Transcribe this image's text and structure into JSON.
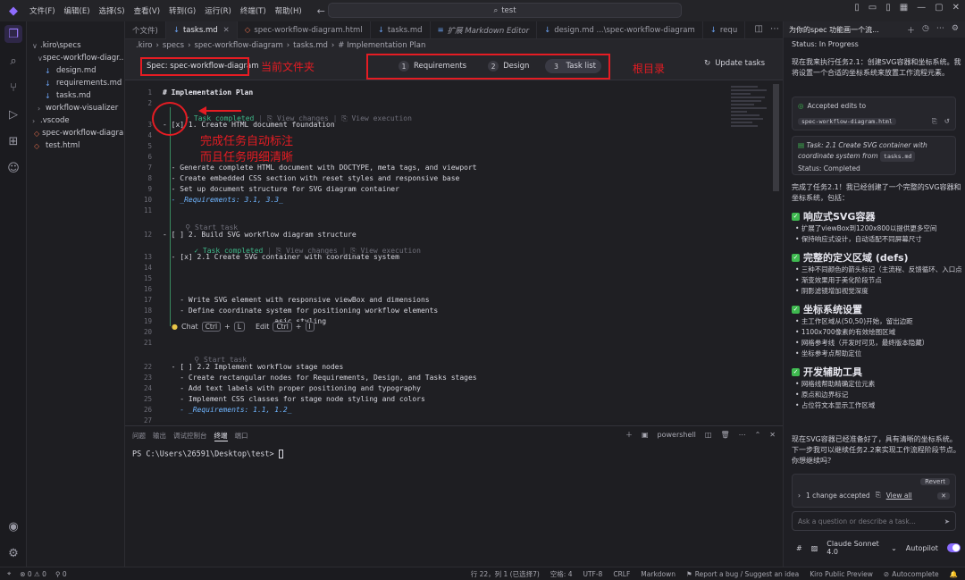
{
  "titlebar": {
    "menu": [
      "文件(F)",
      "编辑(E)",
      "选择(S)",
      "查看(V)",
      "转到(G)",
      "运行(R)",
      "终端(T)",
      "帮助(H)"
    ],
    "search": "test"
  },
  "explorer": {
    "items": [
      {
        "label": ".kiro\\specs",
        "indent": 0,
        "chev": "∨",
        "type": "folder"
      },
      {
        "label": "spec-workflow-diagr...",
        "indent": 1,
        "chev": "∨",
        "type": "folder"
      },
      {
        "label": "design.md",
        "indent": 2,
        "chev": "",
        "type": "md"
      },
      {
        "label": "requirements.md",
        "indent": 2,
        "chev": "",
        "type": "md"
      },
      {
        "label": "tasks.md",
        "indent": 2,
        "chev": "",
        "type": "md"
      },
      {
        "label": "workflow-visualizer",
        "indent": 1,
        "chev": "›",
        "type": "folder"
      },
      {
        "label": ".vscode",
        "indent": 0,
        "chev": "›",
        "type": "folder"
      },
      {
        "label": "spec-workflow-diagra...",
        "indent": 0,
        "chev": "",
        "type": "html"
      },
      {
        "label": "test.html",
        "indent": 0,
        "chev": "",
        "type": "html"
      }
    ]
  },
  "tabs": [
    {
      "label": "个文件)",
      "type": "none",
      "active": false
    },
    {
      "label": "tasks.md",
      "type": "md",
      "active": true
    },
    {
      "label": "spec-workflow-diagram.html",
      "type": "html",
      "active": false
    },
    {
      "label": "tasks.md",
      "type": "md",
      "active": false
    },
    {
      "label": "扩展 Markdown Editor",
      "type": "ext",
      "active": false
    },
    {
      "label": "design.md ...\\spec-workflow-diagram",
      "type": "md",
      "active": false
    },
    {
      "label": "requ",
      "type": "md",
      "active": false
    }
  ],
  "breadcrumb": [
    ".kiro",
    "›",
    "specs",
    "›",
    "spec-workflow-diagram",
    "›",
    "tasks.md",
    "›",
    "# Implementation Plan"
  ],
  "spec": {
    "label": "Spec: spec-workflow-diagram",
    "steps": [
      {
        "num": "1",
        "label": "Requirements"
      },
      {
        "num": "2",
        "label": "Design"
      },
      {
        "num": "3",
        "label": "Task list"
      }
    ],
    "update": "Update tasks"
  },
  "annotations": {
    "current_folder": "当前文件夹",
    "root": "根目录",
    "auto_mark_1": "完成任务自动标注",
    "auto_mark_2": "而且任务明细清晰"
  },
  "editor": {
    "lines": [
      {
        "n": "1",
        "text": "# Implementation Plan",
        "cls": "h"
      },
      {
        "n": "2",
        "text": "",
        "cls": ""
      },
      {
        "n": "3",
        "text": "- [x] 1. Create HTML document foundation",
        "cls": ""
      },
      {
        "n": "4",
        "text": "",
        "cls": ""
      },
      {
        "n": "5",
        "text": "",
        "cls": ""
      },
      {
        "n": "6",
        "text": "",
        "cls": ""
      },
      {
        "n": "7",
        "text": "  - Generate complete HTML document with DOCTYPE, meta tags, and viewport",
        "cls": ""
      },
      {
        "n": "8",
        "text": "  - Create embedded CSS section with reset styles and responsive base",
        "cls": ""
      },
      {
        "n": "9",
        "text": "  - Set up document structure for SVG diagram container",
        "cls": ""
      },
      {
        "n": "10",
        "text": "  - _Requirements: 3.1, 3.3_",
        "cls": "req"
      },
      {
        "n": "11",
        "text": "",
        "cls": ""
      },
      {
        "n": "12",
        "text": "- [ ] 2. Build SVG workflow diagram structure",
        "cls": ""
      },
      {
        "n": "13",
        "text": "  - [x] 2.1 Create SVG container with coordinate system",
        "cls": ""
      },
      {
        "n": "14",
        "text": "",
        "cls": ""
      },
      {
        "n": "15",
        "text": "",
        "cls": ""
      },
      {
        "n": "16",
        "text": "",
        "cls": ""
      },
      {
        "n": "17",
        "text": "    - Write SVG element with responsive viewBox and dimensions",
        "cls": ""
      },
      {
        "n": "18",
        "text": "    - Define coordinate system for positioning workflow elements",
        "cls": ""
      },
      {
        "n": "19",
        "text": "                          asic styling",
        "cls": ""
      },
      {
        "n": "20",
        "text": "",
        "cls": ""
      },
      {
        "n": "21",
        "text": "",
        "cls": ""
      },
      {
        "n": "22",
        "text": "  - [ ] 2.2 Implement workflow stage nodes",
        "cls": ""
      },
      {
        "n": "23",
        "text": "    - Create rectangular nodes for Requirements, Design, and Tasks stages",
        "cls": ""
      },
      {
        "n": "24",
        "text": "    - Add text labels with proper positioning and typography",
        "cls": ""
      },
      {
        "n": "25",
        "text": "    - Implement CSS classes for stage node styling and colors",
        "cls": ""
      },
      {
        "n": "26",
        "text": "    - _Requirements: 1.1, 1.2_",
        "cls": "req"
      },
      {
        "n": "27",
        "text": "",
        "cls": ""
      }
    ],
    "lens_completed": "Task completed",
    "lens_view_changes": "View changes",
    "lens_view_exec": "View execution",
    "lens_start": "Start task",
    "hint_chat": "Chat",
    "hint_edit": "Edit",
    "hint_ctrl": "Ctrl",
    "hint_l": "L",
    "hint_i": "I"
  },
  "panel": {
    "tabs": [
      "问题",
      "输出",
      "调试控制台",
      "终端",
      "端口"
    ],
    "active_tab": "终端",
    "shell": "powershell",
    "prompt": "PS C:\\Users\\26591\\Desktop\\test> "
  },
  "chat": {
    "title": "为你的spec 功能画一个流...",
    "status_in_progress": "Status: In Progress",
    "intro": "现在我来执行任务2.1：创建SVG容器和坐标系统。我将设置一个合适的坐标系统来放置工作流程元素。",
    "accepted": "Accepted edits to",
    "accepted_file": "spec-workflow-diagram.html",
    "task_label": "Task: 2.1 Create SVG container with coordinate system from",
    "task_file": "tasks.md",
    "status_completed": "Status: Completed",
    "done_text": "完成了任务2.1！我已经创建了一个完整的SVG容器和坐标系统，包括：",
    "sections": [
      {
        "title": "响应式SVG容器",
        "bullets": [
          "扩展了viewBox到1200x800以提供更多空间",
          "保持响应式设计，自动适配不同屏幕尺寸"
        ]
      },
      {
        "title": "完整的定义区域 (defs)",
        "bullets": [
          "三种不同颜色的箭头标记（主流程、反馈循环、入口点）",
          "渐变效果用于美化阶段节点",
          "阴影滤镜增加视觉深度"
        ]
      },
      {
        "title": "坐标系统设置",
        "bullets": [
          "主工作区域从(50,50)开始，留出边距",
          "1100x700像素的有效绘图区域",
          "网格参考线（开发时可见，最终版本隐藏）",
          "坐标参考点帮助定位"
        ]
      },
      {
        "title": "开发辅助工具",
        "bullets": [
          "网格线帮助精确定位元素",
          "原点和边界标记",
          "占位符文本显示工作区域"
        ]
      }
    ],
    "outro": "现在SVG容器已经准备好了，具有清晰的坐标系统。下一步我可以继续任务2.2来实现工作流程阶段节点。你想继续吗？",
    "changes": "1 change accepted",
    "view_all": "View all",
    "revert": "Revert",
    "input_placeholder": "Ask a question or describe a task...",
    "model": "Claude Sonnet 4.0",
    "autopilot": "Autopilot"
  },
  "status": {
    "left": [
      "⊗ 0 ⚠ 0",
      "⚲ 0"
    ],
    "position": "行 22，列 1 (已选择7)",
    "spaces": "空格: 4",
    "encoding": "UTF-8",
    "eol": "CRLF",
    "lang": "Markdown",
    "report": "Report a bug / Suggest an idea",
    "kiro": "Kiro Public Preview",
    "autocomplete": "Autocomplete"
  },
  "colors": {
    "accent": "#8f6cff",
    "annotation": "#e51c23",
    "completed": "#3fb98a"
  }
}
